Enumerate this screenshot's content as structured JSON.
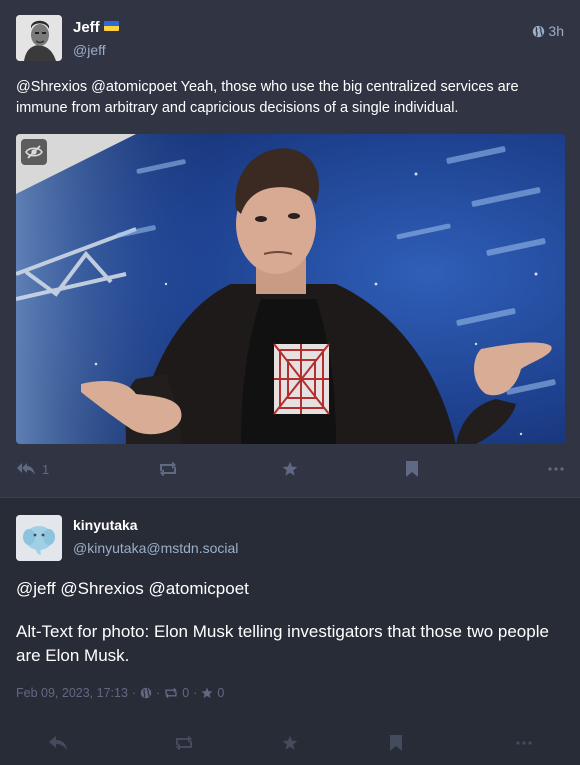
{
  "post1": {
    "author_name": "Jeff",
    "author_handle": "@jeff",
    "time": "3h",
    "mention1": "@Shrexios",
    "mention2": "@atomicpoet",
    "text": "Yeah, those who use the big centralized services are immune from arbitrary and capricious decisions of a single individual.",
    "reply_count": "1",
    "icons": [
      "globe-icon",
      "reply-all-icon",
      "boost-icon",
      "star-icon",
      "bookmark-icon",
      "more-icon",
      "eye-slash-icon"
    ]
  },
  "post2": {
    "author_name": "kinyutaka",
    "author_handle": "@kinyutaka@mstdn.social",
    "mentions_line": "@jeff @Shrexios @atomicpoet",
    "text": "Alt-Text for photo: Elon Musk telling investigators that those two people are Elon Musk.",
    "date": "Feb 09, 2023, 17:13",
    "sep": "·",
    "boosts": "0",
    "favourites": "0",
    "icons": [
      "globe-icon",
      "reply-icon",
      "boost-icon",
      "star-icon",
      "bookmark-icon",
      "more-icon"
    ]
  },
  "colors": {
    "background": "#282c37",
    "card": "#313543",
    "muted": "#606984",
    "secondary": "#9baec8"
  }
}
